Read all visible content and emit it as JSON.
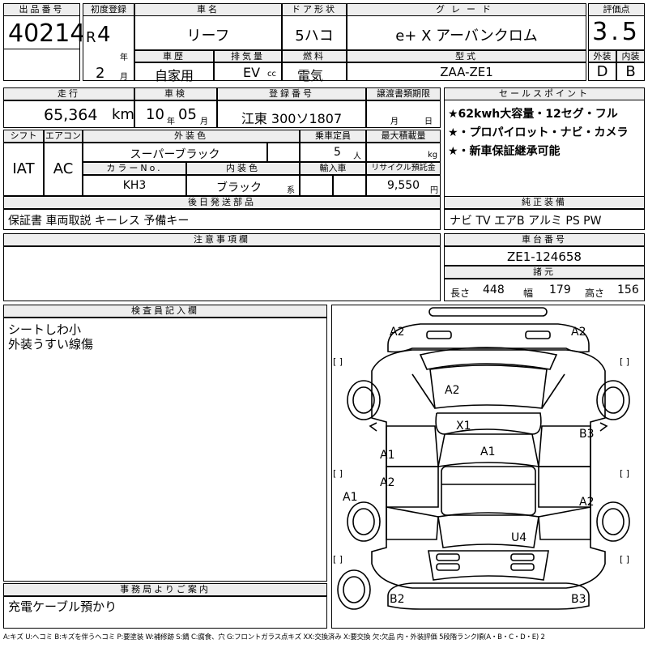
{
  "h": {
    "lot": "出品番号",
    "first_reg": "初度登録",
    "car_name": "車名",
    "door": "ドア形状",
    "grade": "グレード",
    "score": "評価点",
    "history": "車歴",
    "displacement": "排気量",
    "fuel": "燃料",
    "model": "型式",
    "exterior": "外装",
    "interior": "内装",
    "mileage": "走行",
    "inspection": "車検",
    "regno": "登録番号",
    "transfer": "譲渡書類期限",
    "sales": "セールスポイント",
    "shift": "シフト",
    "ac": "エアコン",
    "color": "外装色",
    "capacity": "乗車定員",
    "load": "最大積載量",
    "color_no": "カラーNo.",
    "int_color": "内装色",
    "import": "輸入車",
    "recycle": "リサイクル預託金",
    "parts": "後日発送部品",
    "equipment": "純正装備",
    "notes": "注意事項欄",
    "chassis": "車台番号",
    "dims": "諸元",
    "inspector": "検査員記入欄",
    "office": "事務局よりご案内"
  },
  "lot_no": "40214",
  "reg": {
    "era": "R",
    "year": "4",
    "year_unit": "年",
    "month": "2",
    "month_unit": "月"
  },
  "car_name": "リーフ",
  "door": "5ハコ",
  "grade": "e+ X アーバンクロム",
  "score": "3.5",
  "history": "自家用",
  "displacement": "EV",
  "cc": "cc",
  "fuel": "電気",
  "model": "ZAA-ZE1",
  "exterior_grade": "D",
  "interior_grade": "B",
  "mileage": "65,364",
  "km": "km",
  "inspection": {
    "year": "10",
    "year_unit": "年",
    "month": "05",
    "month_unit": "月"
  },
  "regno": "江東 300ソ1807",
  "transfer": {
    "month": "月",
    "day": "日"
  },
  "sales_points": [
    "★62kwh大容量・12セグ・フル",
    "★・プロパイロット・ナビ・カメラ",
    "★・新車保証継承可能"
  ],
  "shift": "IAT",
  "ac": "AC",
  "color": "スーパーブラック",
  "capacity": "5",
  "person": "人",
  "kg": "kg",
  "color_no": "KH3",
  "int_color": "ブラック",
  "kei": "系",
  "recycle": "9,550",
  "yen": "円",
  "parts": "保証書 車両取説 キーレス 予備キー",
  "equipment": "ナビ TV エアB アルミ PS PW",
  "chassis": "ZE1-124658",
  "dims": {
    "len_label": "長さ",
    "len": "448",
    "wid_label": "幅",
    "wid": "179",
    "hgt_label": "高さ",
    "hgt": "156"
  },
  "inspector_notes": [
    "シートしわ小",
    "外装うすい線傷"
  ],
  "office_note": "充電ケーブル預かり",
  "diagram_marks": [
    "A2",
    "A2",
    "A2",
    "X1",
    "A1",
    "A1",
    "A2",
    "B3",
    "A1",
    "A2",
    "U4",
    "B2",
    "B3"
  ],
  "bracket": "[ ]",
  "legend": "A:キズ U:ヘコミ B:キズを伴うヘコミ P:要塗装 W:補修跡 S:錆 C:腐食、穴 G:フロントガラス点キズ XX:交換済み X:要交換 欠:欠品 内・外装評価 5段階ランク順(A・B・C・D・E) 2"
}
